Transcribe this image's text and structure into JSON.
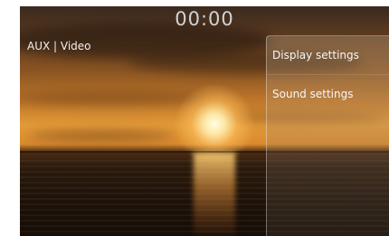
{
  "status_bar": {
    "clock": "00:00"
  },
  "source": {
    "label": "AUX | Video"
  },
  "side_menu": {
    "items": [
      {
        "label": "Display settings"
      },
      {
        "label": "Sound settings"
      }
    ]
  }
}
